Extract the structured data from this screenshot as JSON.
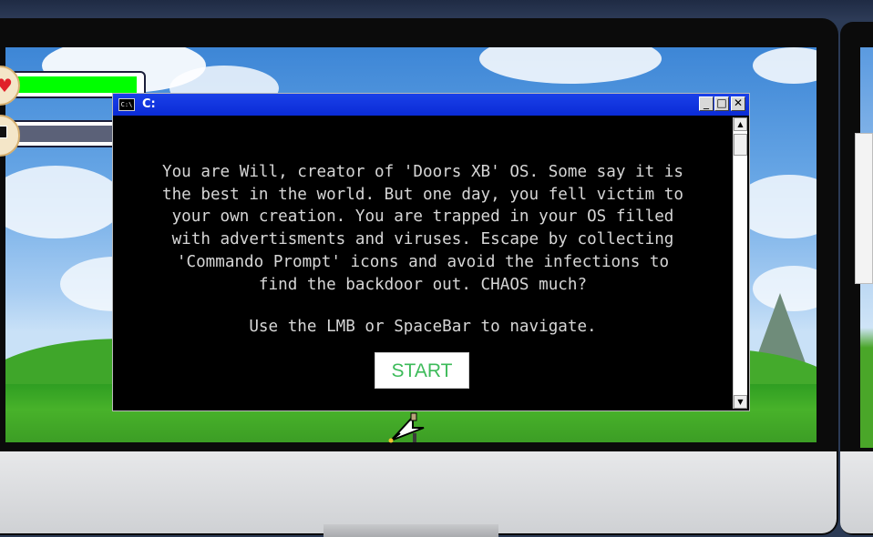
{
  "game": {
    "hud": {
      "health_fraction": 1.0,
      "health_color": "#00ff00",
      "energy_fraction": 0.0,
      "heart_icon": "♥",
      "prompt_icon_name": "command-prompt-icon"
    },
    "window": {
      "title": "C:",
      "icon_text": "C:\\",
      "minimize_label": "_",
      "maximize_label": "□",
      "close_label": "✕",
      "scroll_up": "▲",
      "scroll_down": "▼",
      "story_text": "You are Will, creator of 'Doors XB' OS. Some say it is\nthe best in the world. But one day, you fell victim to\nyour own creation. You are trapped in your OS filled\nwith advertisments and viruses. Escape by collecting\n'Commando Prompt' icons and avoid the infections to\nfind the backdoor out. CHAOS much?",
      "instruction_text": "Use the LMB or SpaceBar to navigate.",
      "start_label": "START"
    },
    "colors": {
      "titlebar": "#0a2bd6",
      "start_text": "#3dbb5a",
      "terminal_text": "#d6d6d6"
    }
  }
}
